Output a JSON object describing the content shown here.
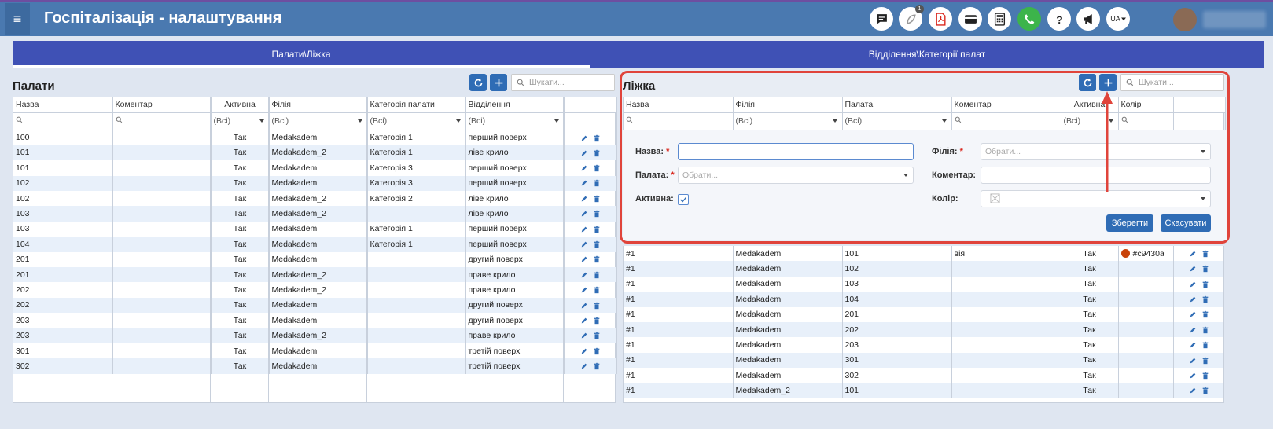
{
  "app": {
    "title": "Госпіталізація - налаштування",
    "menu_glyph": "≡",
    "lang": "UA",
    "notification_count": "1"
  },
  "toolbar_icons": [
    "chat-icon",
    "feather-icon",
    "pdf-icon",
    "card-icon",
    "calculator-icon",
    "phone-icon",
    "help-icon",
    "megaphone-icon"
  ],
  "tabs": [
    {
      "label": "Палати\\Ліжка",
      "active": true
    },
    {
      "label": "Відділення\\Категорії палат",
      "active": false
    }
  ],
  "rooms": {
    "title": "Палати",
    "search_placeholder": "Шукати...",
    "columns": [
      "Назва",
      "Коментар",
      "Активна",
      "Філія",
      "Категорія палати",
      "Відділення",
      ""
    ],
    "filters": {
      "all": "(Всі)"
    },
    "rows": [
      [
        "100",
        "",
        "Так",
        "Medakadem",
        "Категорія 1",
        "перший поверх"
      ],
      [
        "101",
        "",
        "Так",
        "Medakadem_2",
        "Категорія 1",
        "ліве крило"
      ],
      [
        "101",
        "",
        "Так",
        "Medakadem",
        "Категорія 3",
        "перший поверх"
      ],
      [
        "102",
        "",
        "Так",
        "Medakadem",
        "Категорія 3",
        "перший поверх"
      ],
      [
        "102",
        "",
        "Так",
        "Medakadem_2",
        "Категорія 2",
        "ліве крило"
      ],
      [
        "103",
        "",
        "Так",
        "Medakadem_2",
        "",
        "ліве крило"
      ],
      [
        "103",
        "",
        "Так",
        "Medakadem",
        "Категорія 1",
        "перший поверх"
      ],
      [
        "104",
        "",
        "Так",
        "Medakadem",
        "Категорія 1",
        "перший поверх"
      ],
      [
        "201",
        "",
        "Так",
        "Medakadem",
        "",
        "другий поверх"
      ],
      [
        "201",
        "",
        "Так",
        "Medakadem_2",
        "",
        "праве крило"
      ],
      [
        "202",
        "",
        "Так",
        "Medakadem_2",
        "",
        "праве крило"
      ],
      [
        "202",
        "",
        "Так",
        "Medakadem",
        "",
        "другий поверх"
      ],
      [
        "203",
        "",
        "Так",
        "Medakadem",
        "",
        "другий поверх"
      ],
      [
        "203",
        "",
        "Так",
        "Medakadem_2",
        "",
        "праве крило"
      ],
      [
        "301",
        "",
        "Так",
        "Medakadem",
        "",
        "третій поверх"
      ],
      [
        "302",
        "",
        "Так",
        "Medakadem",
        "",
        "третій поверх"
      ]
    ]
  },
  "beds": {
    "title": "Ліжка",
    "search_placeholder": "Шукати...",
    "columns": [
      "Назва",
      "Філія",
      "Палата",
      "Коментар",
      "Активна",
      "Колір",
      ""
    ],
    "filters": {
      "all": "(Всі)"
    },
    "form": {
      "name_label": "Назва:",
      "branch_label": "Філія:",
      "room_label": "Палата:",
      "comment_label": "Коментар:",
      "active_label": "Активна:",
      "color_label": "Колір:",
      "select_placeholder": "Обрати...",
      "required_mark": "*",
      "save_label": "Зберегти",
      "cancel_label": "Скасувати"
    },
    "rows": [
      [
        "#1",
        "Medakadem",
        "101",
        "вія",
        "Так",
        "#c9430a"
      ],
      [
        "#1",
        "Medakadem",
        "102",
        "",
        "Так",
        ""
      ],
      [
        "#1",
        "Medakadem",
        "103",
        "",
        "Так",
        ""
      ],
      [
        "#1",
        "Medakadem",
        "104",
        "",
        "Так",
        ""
      ],
      [
        "#1",
        "Medakadem",
        "201",
        "",
        "Так",
        ""
      ],
      [
        "#1",
        "Medakadem",
        "202",
        "",
        "Так",
        ""
      ],
      [
        "#1",
        "Medakadem",
        "203",
        "",
        "Так",
        ""
      ],
      [
        "#1",
        "Medakadem",
        "301",
        "",
        "Так",
        ""
      ],
      [
        "#1",
        "Medakadem",
        "302",
        "",
        "Так",
        ""
      ],
      [
        "#1",
        "Medakadem_2",
        "101",
        "",
        "Так",
        ""
      ]
    ]
  },
  "colors": {
    "accent": "#2f6cb5",
    "header": "#4a79b0",
    "tabs": "#3f51b5",
    "highlight": "#e0443b",
    "bed_color": "#c9430a"
  }
}
